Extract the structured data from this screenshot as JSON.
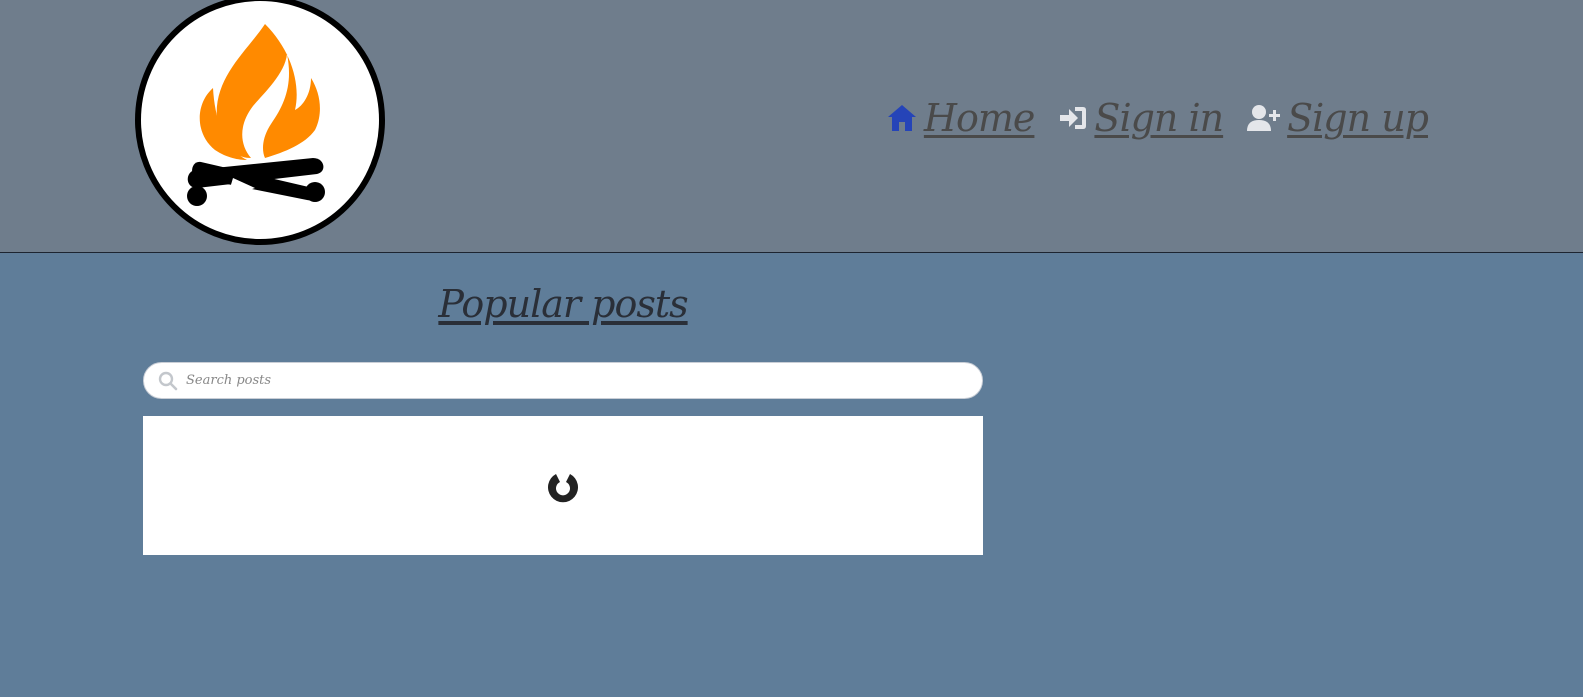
{
  "header": {
    "logo": {
      "icon": "campfire-logo-icon",
      "colors": {
        "flame": "#ff8a00",
        "logs": "#000000",
        "badge": "#ffffff"
      }
    },
    "nav": [
      {
        "label": "Home",
        "icon": "home-icon",
        "icon_color": "#2544b8"
      },
      {
        "label": "Sign in",
        "icon": "sign-in-icon",
        "icon_color": "#e4e6ea"
      },
      {
        "label": "Sign up",
        "icon": "user-plus-icon",
        "icon_color": "#e4e6ea"
      }
    ]
  },
  "main": {
    "title": "Popular posts",
    "search": {
      "placeholder": "Search posts",
      "value": "",
      "icon": "search-icon"
    },
    "posts_panel": {
      "state": "loading",
      "icon": "spinner-icon"
    }
  },
  "colors": {
    "header_bg": "#6f7d8c",
    "page_bg": "#5f7d99",
    "text_dark": "#2a2f38"
  }
}
